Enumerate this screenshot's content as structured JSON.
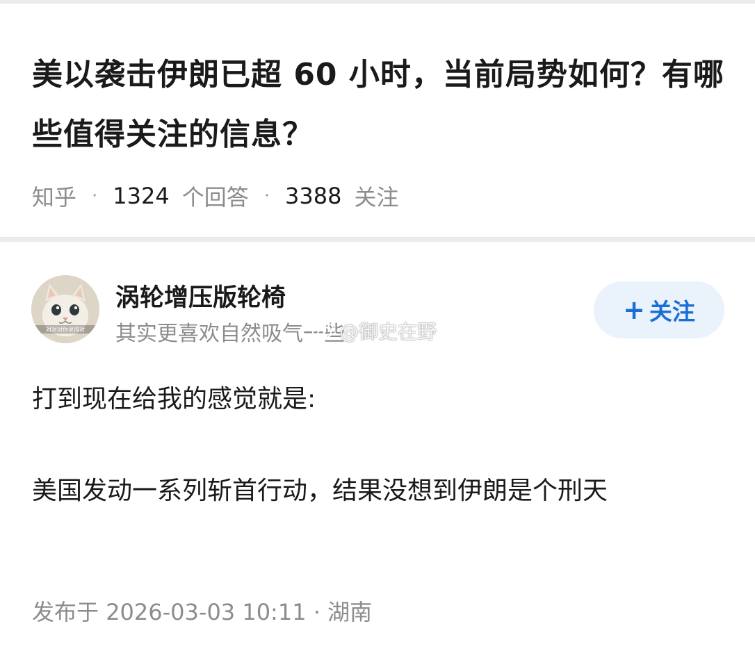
{
  "question": {
    "title": "美以袭击伊朗已超 60 小时，当前局势如何？有哪些值得关注的信息？",
    "source": "知乎",
    "answer_count": "1324",
    "answer_label": "个回答",
    "follower_count": "3388",
    "follower_label": "关注"
  },
  "answer": {
    "author_name": "涡轮增压版轮椅",
    "author_bio": "其实更喜欢自然吸气一些",
    "avatar_caption": "对对对你说得对",
    "follow_button_label": "关注",
    "paragraphs": [
      "打到现在给我的感觉就是:",
      "美国发动一系列斩首行动，结果没想到伊朗是个刑天"
    ],
    "publish_label": "发布于",
    "publish_time": "2026-03-03 10:11",
    "location": "湖南"
  },
  "watermark": {
    "text": "@御史在野",
    "icon": "weibo-icon"
  },
  "colors": {
    "accent": "#1a6fd6",
    "follow_bg": "#eaf2fb",
    "muted": "#8c8c8c",
    "text": "#1a1a1a"
  }
}
